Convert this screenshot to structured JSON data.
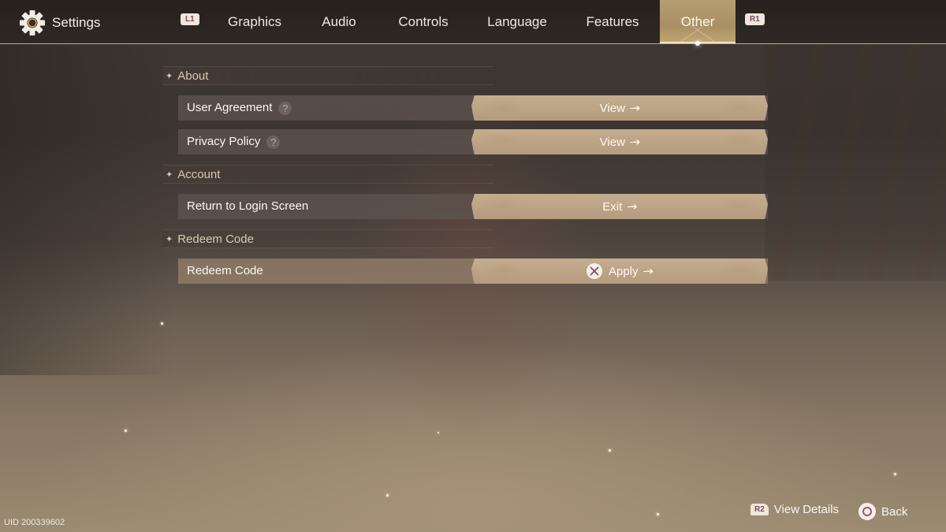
{
  "header": {
    "title": "Settings",
    "title_icon": "gear-icon",
    "prev_tab_button": "L1",
    "next_tab_button": "R1",
    "tabs": [
      {
        "label": "Graphics",
        "active": false
      },
      {
        "label": "Audio",
        "active": false
      },
      {
        "label": "Controls",
        "active": false
      },
      {
        "label": "Language",
        "active": false
      },
      {
        "label": "Features",
        "active": false
      },
      {
        "label": "Other",
        "active": true
      }
    ]
  },
  "sections": [
    {
      "title": "About",
      "rows": [
        {
          "label": "User Agreement",
          "has_help": true,
          "action": "View",
          "action_icon": "arrow-right-icon"
        },
        {
          "label": "Privacy Policy",
          "has_help": true,
          "action": "View",
          "action_icon": "arrow-right-icon"
        }
      ]
    },
    {
      "title": "Account",
      "rows": [
        {
          "label": "Return to Login Screen",
          "has_help": false,
          "action": "Exit",
          "action_icon": "arrow-right-icon"
        }
      ]
    },
    {
      "title": "Redeem Code",
      "rows": [
        {
          "label": "Redeem Code",
          "has_help": false,
          "action": "Apply",
          "action_prefix_icon": "cross-button-icon",
          "action_icon": "arrow-right-icon",
          "selected": true
        }
      ]
    }
  ],
  "help_glyph": "?",
  "section_glyph": "✦",
  "arrow_glyph": "-➔",
  "footer": {
    "uid": "UID 200339602",
    "hints": [
      {
        "button": "R2",
        "label": "View Details"
      },
      {
        "button": "circle",
        "label": "Back"
      }
    ]
  },
  "colors": {
    "active_tab": "#b79d72",
    "action_button": "#bca487",
    "button_badge_text": "#7c4a5f"
  }
}
